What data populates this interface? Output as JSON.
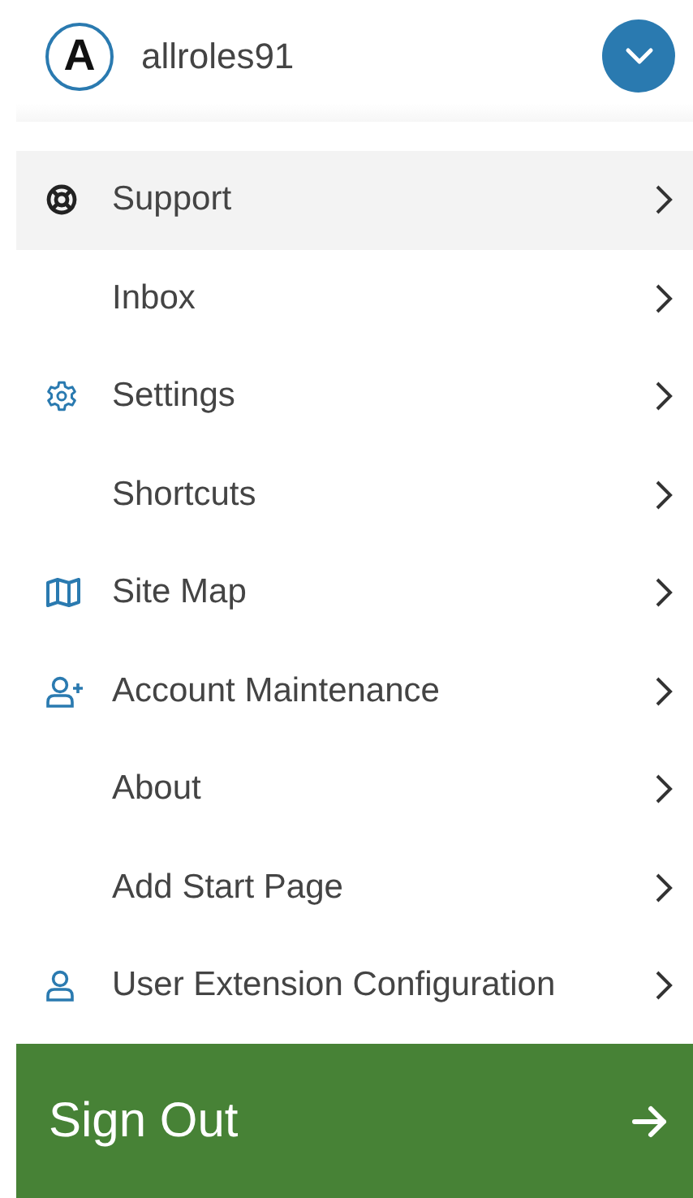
{
  "user": {
    "initial": "A",
    "name": "allroles91"
  },
  "menu": [
    {
      "label": "Support",
      "kind": "lifebuoy",
      "selected": true
    },
    {
      "label": "Inbox",
      "kind": "plain",
      "selected": false
    },
    {
      "label": "Settings",
      "kind": "gear",
      "selected": false
    },
    {
      "label": "Shortcuts",
      "kind": "plain",
      "selected": false
    },
    {
      "label": "Site Map",
      "kind": "map",
      "selected": false
    },
    {
      "label": "Account Maintenance",
      "kind": "adduser",
      "selected": false
    },
    {
      "label": "About",
      "kind": "plain",
      "selected": false
    },
    {
      "label": "Add Start Page",
      "kind": "plain",
      "selected": false
    },
    {
      "label": "User Extension Configuration",
      "kind": "user",
      "selected": false
    }
  ],
  "sign_out": {
    "label": "Sign Out"
  }
}
